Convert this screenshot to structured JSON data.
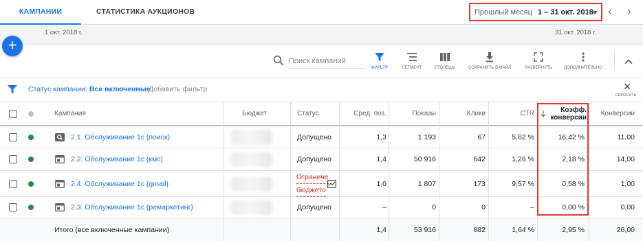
{
  "tabs": [
    {
      "label": "КАМПАНИИ",
      "active": true
    },
    {
      "label": "СТАТИСТИКА АУКЦИОНОВ",
      "active": false
    }
  ],
  "date_picker": {
    "preset": "Прошлый месяц",
    "range": "1 – 31 окт. 2018"
  },
  "timeline": {
    "start": "1 окт. 2018 г.",
    "end": "31 окт. 2018 г."
  },
  "search": {
    "placeholder": "Поиск кампаний"
  },
  "toolbar": {
    "filter": "ФИЛЬТР",
    "segment": "СЕГМЕНТ",
    "columns": "СТОЛБЦЫ",
    "download": "СОХРАНИТЬ В ФАЙЛ",
    "expand": "РАЗВЕРНУТЬ",
    "more": "ДОПОЛНИТЕЛЬНО"
  },
  "filter_bar": {
    "chip_prefix": "Статус кампании:",
    "chip_value": "Все включенные",
    "add_filter": "Добавить фильтр",
    "reset": "СБРОСИТЬ"
  },
  "table": {
    "headers": {
      "campaign": "Кампания",
      "budget": "Бюджет",
      "status": "Статус",
      "avg_pos": "Сред. поз.",
      "impressions": "Показы",
      "clicks": "Клики",
      "ctr": "CTR",
      "conv_rate_line1": "Коэфф.",
      "conv_rate_line2": "конверсии",
      "conversions": "Конверсии"
    },
    "rows": [
      {
        "name": "2.1. Обслуживание 1с (поиск)",
        "type_icon": "search-campaign-icon",
        "status": "Допущено",
        "avg_pos": "1,3",
        "impressions": "1 193",
        "clicks": "67",
        "ctr": "5,62 %",
        "conv_rate": "16,42 %",
        "conversions": "11,00"
      },
      {
        "name": "2.2. Обслуживание 1с (кмс)",
        "type_icon": "display-campaign-icon",
        "status": "Допущено",
        "avg_pos": "1,4",
        "impressions": "50 916",
        "clicks": "642",
        "ctr": "1,26 %",
        "conv_rate": "2,18 %",
        "conversions": "14,00"
      },
      {
        "name": "2.4. Обслуживание 1с (gmail)",
        "type_icon": "display-campaign-icon",
        "status_line1": "Ограниче",
        "status_line2": "бюджето",
        "avg_pos": "1,0",
        "impressions": "1 807",
        "clicks": "173",
        "ctr": "9,57 %",
        "conv_rate": "0,58 %",
        "conversions": "1,00"
      },
      {
        "name": "2.3. Обслуживание 1с (ремаркетинг)",
        "type_icon": "display-campaign-icon",
        "status": "Допущено",
        "avg_pos": "–",
        "impressions": "0",
        "clicks": "0",
        "ctr": "–",
        "conv_rate": "0,00 %",
        "conversions": "0,00"
      }
    ],
    "total": {
      "label": "Итого (все включенные кампании)",
      "avg_pos": "1,4",
      "impressions": "53 916",
      "clicks": "882",
      "ctr": "1,64 %",
      "conv_rate": "2,95 %",
      "conversions": "26,00"
    }
  },
  "colors": {
    "accent": "#1a73e8",
    "highlight": "#e53935",
    "enabled": "#1e8e3e",
    "limited": "#d93025"
  }
}
